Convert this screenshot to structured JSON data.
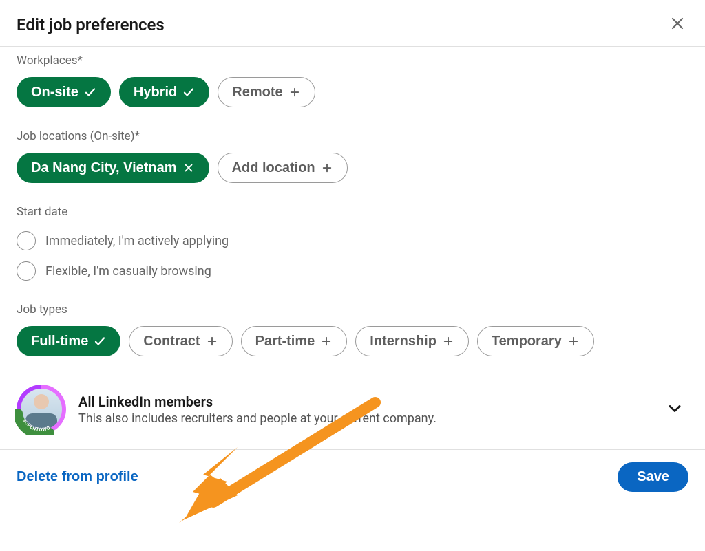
{
  "modal": {
    "title": "Edit job preferences"
  },
  "workplaces": {
    "label": "Workplaces*",
    "options": [
      {
        "label": "On-site",
        "selected": true
      },
      {
        "label": "Hybrid",
        "selected": true
      },
      {
        "label": "Remote",
        "selected": false
      }
    ]
  },
  "locations": {
    "label": "Job locations (On-site)*",
    "items": [
      {
        "label": "Da Nang City, Vietnam",
        "selected": true,
        "removable": true
      }
    ],
    "add_label": "Add location"
  },
  "startDate": {
    "label": "Start date",
    "options": [
      {
        "label": "Immediately, I'm actively applying"
      },
      {
        "label": "Flexible, I'm casually browsing"
      }
    ]
  },
  "jobTypes": {
    "label": "Job types",
    "options": [
      {
        "label": "Full-time",
        "selected": true
      },
      {
        "label": "Contract",
        "selected": false
      },
      {
        "label": "Part-time",
        "selected": false
      },
      {
        "label": "Internship",
        "selected": false
      },
      {
        "label": "Temporary",
        "selected": false
      }
    ]
  },
  "visibility": {
    "title": "All LinkedIn members",
    "subtitle": "This also includes recruiters and people at your current company.",
    "badge_text": "#OPENTOWORK"
  },
  "footer": {
    "delete_label": "Delete from profile",
    "save_label": "Save"
  }
}
